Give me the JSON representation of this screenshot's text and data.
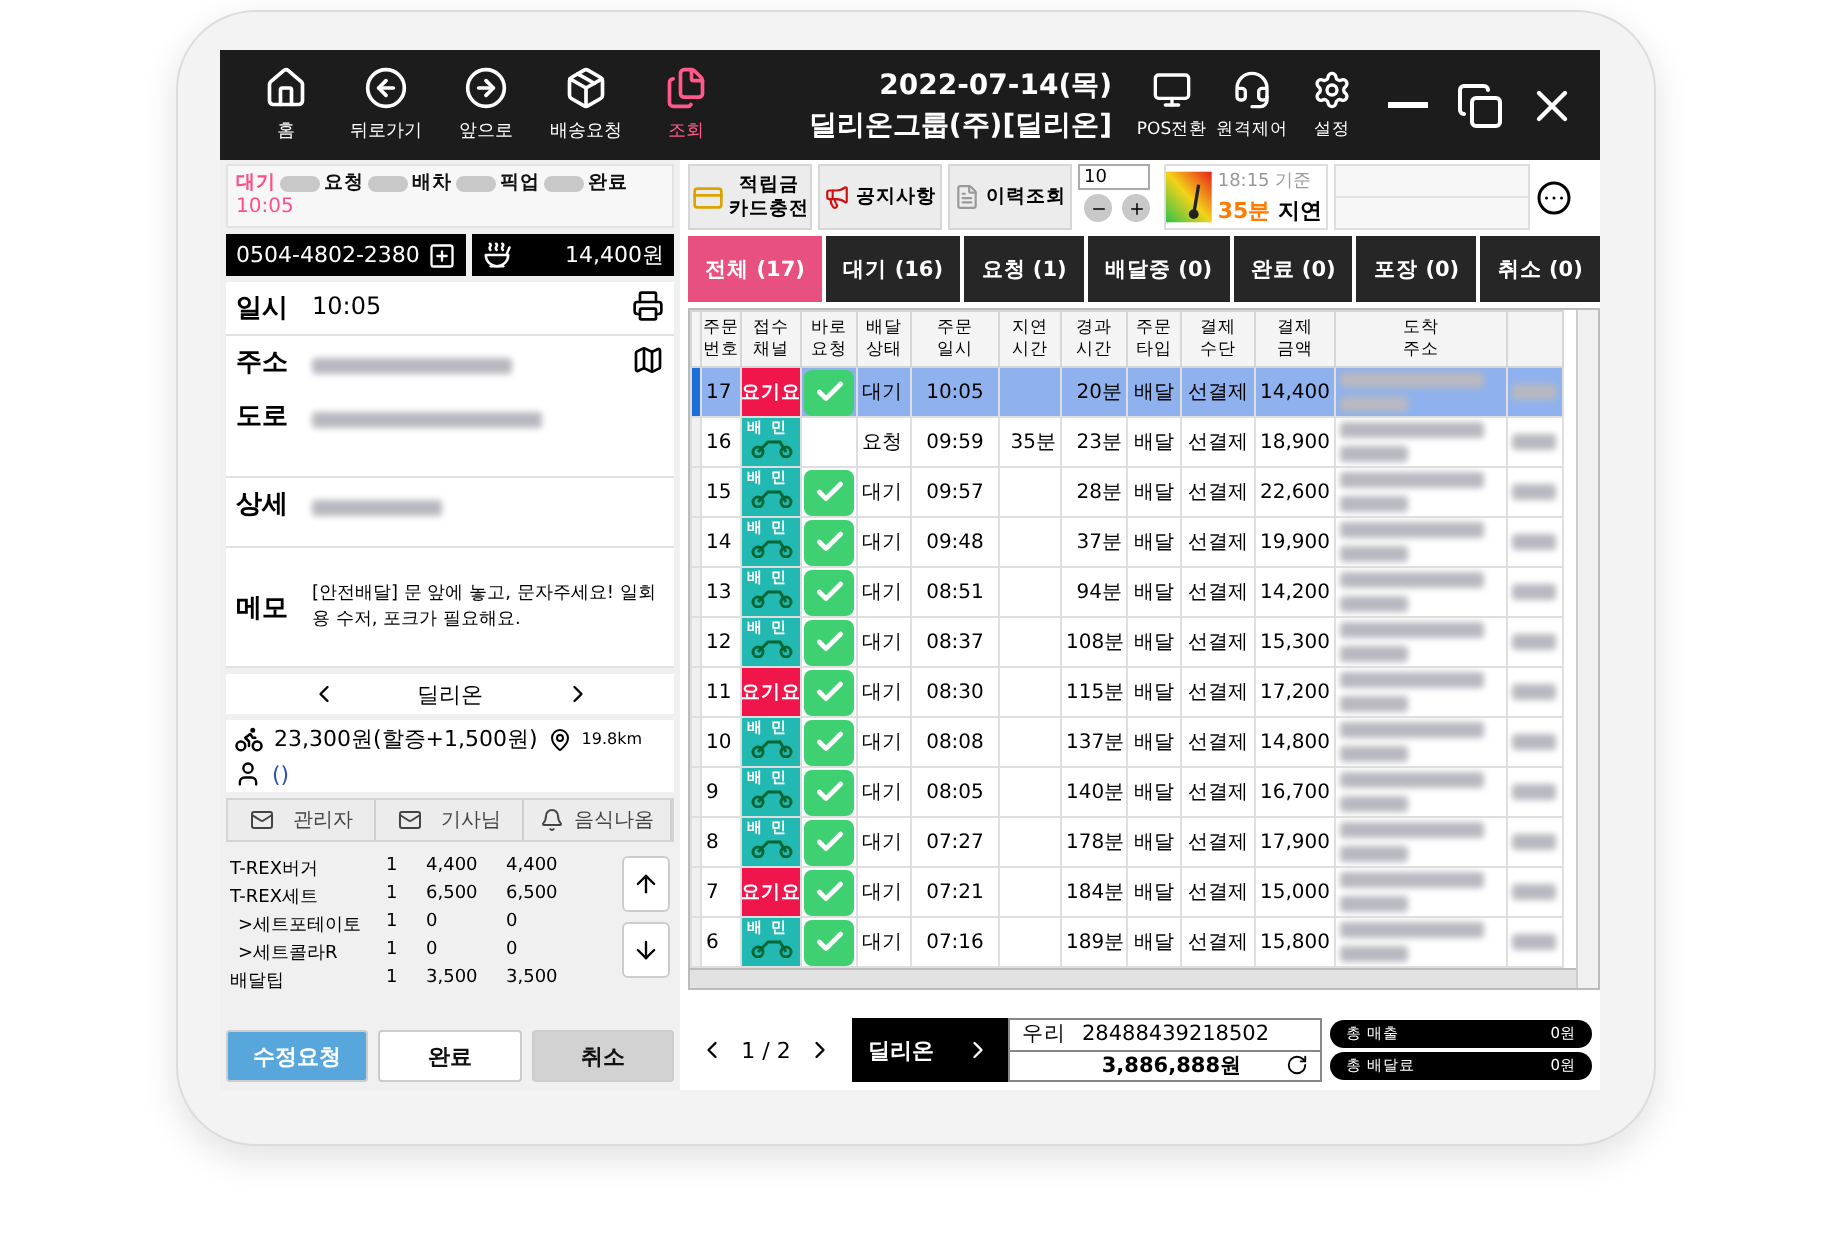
{
  "topbar": {
    "nav": [
      {
        "kind": "home",
        "label": "홈",
        "selected": false
      },
      {
        "kind": "back",
        "label": "뒤로가기",
        "selected": false
      },
      {
        "kind": "forward",
        "label": "앞으로",
        "selected": false
      },
      {
        "kind": "box",
        "label": "배송요청",
        "selected": false
      },
      {
        "kind": "files",
        "label": "조회",
        "selected": true
      }
    ],
    "date": "2022-07-14(목)",
    "store": "딜리온그룹(주)[딜리온]",
    "tools": [
      {
        "kind": "pos",
        "label": "POS전환"
      },
      {
        "kind": "remote",
        "label": "원격제어"
      },
      {
        "kind": "settings",
        "label": "설정"
      }
    ]
  },
  "order": {
    "status_steps": [
      {
        "label": "대기",
        "selected": true
      },
      {
        "label": "요청",
        "selected": false
      },
      {
        "label": "배차",
        "selected": false
      },
      {
        "label": "픽업",
        "selected": false
      },
      {
        "label": "완료",
        "selected": false
      }
    ],
    "status_time": "10:05",
    "phone": "0504-4802-2380",
    "amount": "14,400원",
    "info": [
      {
        "kind": "time",
        "label": "일시",
        "value": "10:05"
      },
      {
        "kind": "address",
        "label": "주소"
      },
      {
        "kind": "road",
        "label": "도로"
      },
      {
        "kind": "detail",
        "label": "상세"
      },
      {
        "kind": "memo",
        "label": "메모",
        "value": "[안전배달] 문 앞에 놓고, 문자주세요! 일회용 수저, 포크가 필요해요."
      }
    ],
    "agency": "딜리온",
    "fee": "23,300원(할증+1,500원)",
    "distance": "19.8km",
    "rider": "()",
    "contacts": [
      {
        "kind": "mail",
        "label": "관리자"
      },
      {
        "kind": "mail",
        "label": "기사님"
      },
      {
        "kind": "bell",
        "label": "음식나옴"
      }
    ],
    "items": [
      {
        "name": "T-REX버거",
        "qty": "1",
        "price": "4,400",
        "total": "4,400"
      },
      {
        "name": "T-REX세트",
        "qty": "1",
        "price": "6,500",
        "total": "6,500",
        "children": [
          {
            "name": ">세트포테이토",
            "qty": "1",
            "price": "0",
            "total": "0"
          },
          {
            "name": ">세트콜라R",
            "qty": "1",
            "price": "0",
            "total": "0"
          }
        ]
      },
      {
        "name": "배달팁",
        "qty": "1",
        "price": "3,500",
        "total": "3,500"
      }
    ],
    "actions": [
      {
        "kind": "primary",
        "label": "수정요청"
      },
      {
        "kind": "plain",
        "label": "완료"
      },
      {
        "kind": "muted",
        "label": "취소"
      }
    ]
  },
  "toolbar": {
    "charge": "적립금\n카드충전",
    "notice": "공지사항",
    "history": "이력조회",
    "count": "10",
    "status_time": "18:15 기준",
    "delay_value": "35분",
    "delay_label": "지연"
  },
  "tabs": [
    {
      "label": "전체 (17)",
      "selected": true
    },
    {
      "label": "대기 (16)",
      "selected": false
    },
    {
      "label": "요청 (1)",
      "selected": false
    },
    {
      "label": "배달중 (0)",
      "selected": false
    },
    {
      "label": "완료 (0)",
      "selected": false
    },
    {
      "label": "포장 (0)",
      "selected": false
    },
    {
      "label": "취소 (0)",
      "selected": false
    }
  ],
  "table": {
    "columns": [
      "주문\n번호",
      "접수\n채널",
      "바로\n요청",
      "배달\n상태",
      "주문\n일시",
      "지연\n시간",
      "경과\n시간",
      "주문\n타입",
      "결제\n수단",
      "결제\n금액",
      "도착\n주소"
    ],
    "rows": [
      {
        "selected": true,
        "number": "17",
        "channel": {
          "kind": "yogiyo",
          "label": "요기요"
        },
        "quick": true,
        "status": "대기",
        "time": "10:05",
        "elapsed": "20분",
        "type": "배달",
        "payment": "선결제",
        "amount": "14,400"
      },
      {
        "selected": false,
        "number": "16",
        "channel": {
          "kind": "baemin",
          "label": "배민"
        },
        "quick": false,
        "status": "요청",
        "time": "09:59",
        "delay": "35분",
        "elapsed": "23분",
        "type": "배달",
        "payment": "선결제",
        "amount": "18,900"
      },
      {
        "selected": false,
        "number": "15",
        "channel": {
          "kind": "baemin",
          "label": "배민"
        },
        "quick": true,
        "status": "대기",
        "time": "09:57",
        "elapsed": "28분",
        "type": "배달",
        "payment": "선결제",
        "amount": "22,600"
      },
      {
        "selected": false,
        "number": "14",
        "channel": {
          "kind": "baemin",
          "label": "배민"
        },
        "quick": true,
        "status": "대기",
        "time": "09:48",
        "elapsed": "37분",
        "type": "배달",
        "payment": "선결제",
        "amount": "19,900"
      },
      {
        "selected": false,
        "number": "13",
        "channel": {
          "kind": "baemin",
          "label": "배민"
        },
        "quick": true,
        "status": "대기",
        "time": "08:51",
        "elapsed": "94분",
        "type": "배달",
        "payment": "선결제",
        "amount": "14,200"
      },
      {
        "selected": false,
        "number": "12",
        "channel": {
          "kind": "baemin",
          "label": "배민"
        },
        "quick": true,
        "status": "대기",
        "time": "08:37",
        "elapsed": "108분",
        "type": "배달",
        "payment": "선결제",
        "amount": "15,300"
      },
      {
        "selected": false,
        "number": "11",
        "channel": {
          "kind": "yogiyo",
          "label": "요기요"
        },
        "quick": true,
        "status": "대기",
        "time": "08:30",
        "elapsed": "115분",
        "type": "배달",
        "payment": "선결제",
        "amount": "17,200"
      },
      {
        "selected": false,
        "number": "10",
        "channel": {
          "kind": "baemin",
          "label": "배민"
        },
        "quick": true,
        "status": "대기",
        "time": "08:08",
        "elapsed": "137분",
        "type": "배달",
        "payment": "선결제",
        "amount": "14,800"
      },
      {
        "selected": false,
        "number": "9",
        "channel": {
          "kind": "baemin",
          "label": "배민"
        },
        "quick": true,
        "status": "대기",
        "time": "08:05",
        "elapsed": "140분",
        "type": "배달",
        "payment": "선결제",
        "amount": "16,700"
      },
      {
        "selected": false,
        "number": "8",
        "channel": {
          "kind": "baemin",
          "label": "배민"
        },
        "quick": true,
        "status": "대기",
        "time": "07:27",
        "elapsed": "178분",
        "type": "배달",
        "payment": "선결제",
        "amount": "17,900"
      },
      {
        "selected": false,
        "number": "7",
        "channel": {
          "kind": "yogiyo",
          "label": "요기요"
        },
        "quick": true,
        "status": "대기",
        "time": "07:21",
        "elapsed": "184분",
        "type": "배달",
        "payment": "선결제",
        "amount": "15,000"
      },
      {
        "selected": false,
        "number": "6",
        "channel": {
          "kind": "baemin",
          "label": "배민"
        },
        "quick": true,
        "status": "대기",
        "time": "07:16",
        "elapsed": "189분",
        "type": "배달",
        "payment": "선결제",
        "amount": "15,800"
      }
    ]
  },
  "pager": "1 / 2",
  "agency_button": "딜리온",
  "account": {
    "bank": "우리",
    "number": "28488439218502",
    "balance": "3,886,888원"
  },
  "totals": [
    {
      "label": "총 매출",
      "value": "0원"
    },
    {
      "label": "총 배달료",
      "value": "0원"
    }
  ]
}
